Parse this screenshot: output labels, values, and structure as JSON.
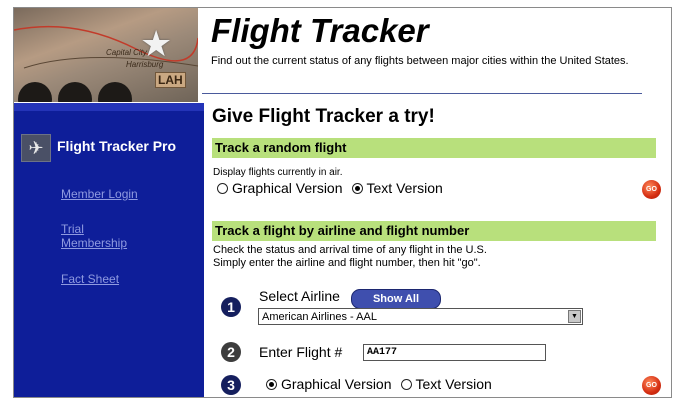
{
  "header": {
    "image_labels": [
      "Capital City",
      "Harrisburg",
      "LAH"
    ],
    "title": "Flight Tracker",
    "subtitle": "Find out the current status of any flights between major cities within the United States."
  },
  "sidebar": {
    "title": "Flight Tracker Pro",
    "icon": "airplane-icon",
    "links": [
      "Member Login",
      "Trial Membership",
      "Fact Sheet"
    ],
    "background": "#0e1e99",
    "link_color": "#8f9ae0"
  },
  "main": {
    "heading": "Give Flight Tracker a try!",
    "random": {
      "header": "Track a random flight",
      "description": "Display flights currently in air.",
      "options": [
        "Graphical Version",
        "Text Version"
      ],
      "selected": "Text Version",
      "go_label": "GO"
    },
    "airline": {
      "header": "Track a flight by airline and flight number",
      "description_1": "Check the status and arrival time of any flight in the U.S.",
      "description_2": "Simply enter the airline and flight number, then hit \"go\".",
      "step_1": "1",
      "select_label": "Select Airline",
      "show_all": "Show All",
      "airline_value": "American Airlines - AAL",
      "step_2": "2",
      "flight_label": "Enter Flight #",
      "flight_value": "AA177",
      "step_3": "3",
      "options": [
        "Graphical Version",
        "Text Version"
      ],
      "selected": "Graphical Version",
      "go_label": "GO"
    },
    "accent_green": "#b8e07c",
    "go_color": "#d52e12"
  }
}
